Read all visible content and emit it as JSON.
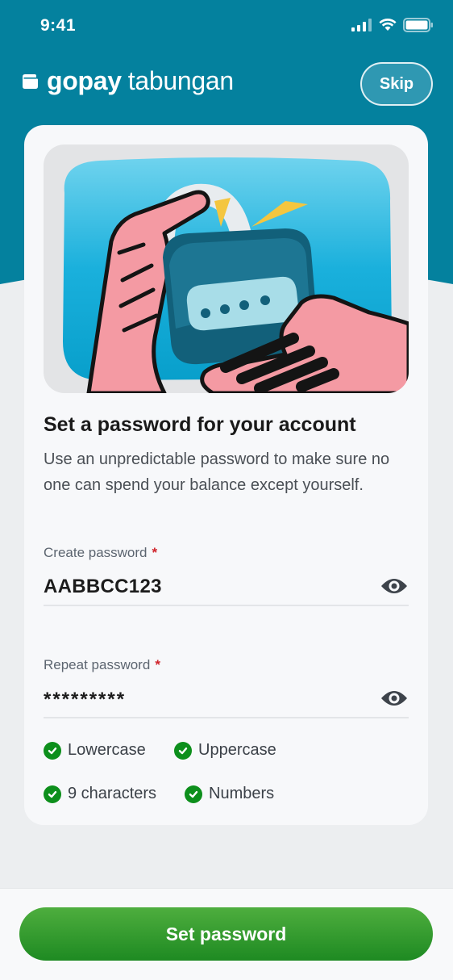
{
  "status_bar": {
    "time": "9:41",
    "icons": [
      "cellular-signal-icon",
      "wifi-icon",
      "battery-icon"
    ]
  },
  "header": {
    "logo_icon": "wallet-icon",
    "brand_primary": "gopay",
    "brand_secondary": "tabungan",
    "skip_label": "Skip"
  },
  "card": {
    "illustration": "hand-holding-padlock-illustration",
    "title": "Set a password for your account",
    "subtitle": "Use an unpredictable password to make sure no one can spend your balance except yourself.",
    "create_password": {
      "label": "Create password",
      "required_mark": "*",
      "value": "AABBCC123",
      "toggle_icon": "eye-icon"
    },
    "repeat_password": {
      "label": "Repeat password",
      "required_mark": "*",
      "value": "*********",
      "toggle_icon": "eye-icon"
    },
    "requirements": [
      {
        "label": "Lowercase",
        "met": true
      },
      {
        "label": "Uppercase",
        "met": true
      },
      {
        "label": "9 characters",
        "met": true
      },
      {
        "label": "Numbers",
        "met": true
      }
    ]
  },
  "footer": {
    "cta_label": "Set password"
  },
  "colors": {
    "header_teal": "#04819e",
    "background": "#eceef0",
    "card": "#f7f8fa",
    "accent_green": "#0d8f1c",
    "required_red": "#d0242b"
  }
}
